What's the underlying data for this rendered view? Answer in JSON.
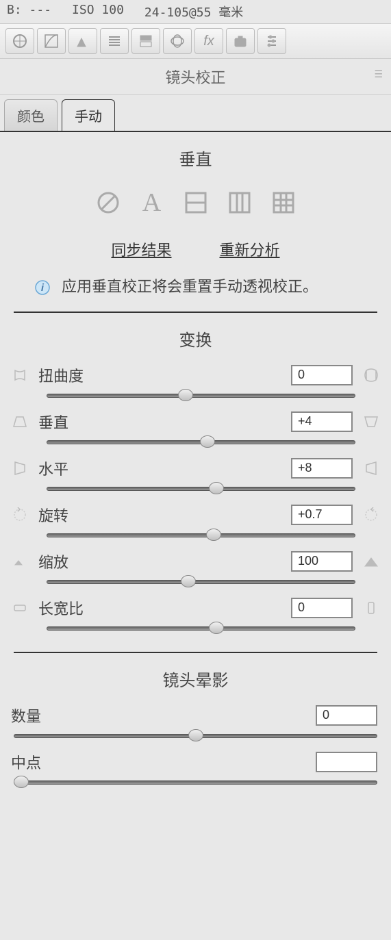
{
  "top_info": {
    "b_label": "B:",
    "b_value": "---",
    "iso": "ISO 100",
    "lens": "24-105@55 毫米"
  },
  "panel": {
    "title": "镜头校正"
  },
  "tabs": {
    "color": "颜色",
    "manual": "手动"
  },
  "upright": {
    "title": "垂直",
    "sync_link": "同步结果",
    "reanalyze_link": "重新分析",
    "info_text": "应用垂直校正将会重置手动透视校正。"
  },
  "transform": {
    "title": "变换",
    "sliders": {
      "distortion": {
        "label": "扭曲度",
        "value": "0",
        "pos": 45
      },
      "vertical": {
        "label": "垂直",
        "value": "+4",
        "pos": 52
      },
      "horizontal": {
        "label": "水平",
        "value": "+8",
        "pos": 55
      },
      "rotate": {
        "label": "旋转",
        "value": "+0.7",
        "pos": 54
      },
      "scale": {
        "label": "缩放",
        "value": "100",
        "pos": 46
      },
      "aspect": {
        "label": "长宽比",
        "value": "0",
        "pos": 55
      }
    }
  },
  "vignette": {
    "title": "镜头晕影",
    "amount": {
      "label": "数量",
      "value": "0",
      "pos": 50
    },
    "midpoint": {
      "label": "中点",
      "value": "",
      "pos": 2
    }
  }
}
